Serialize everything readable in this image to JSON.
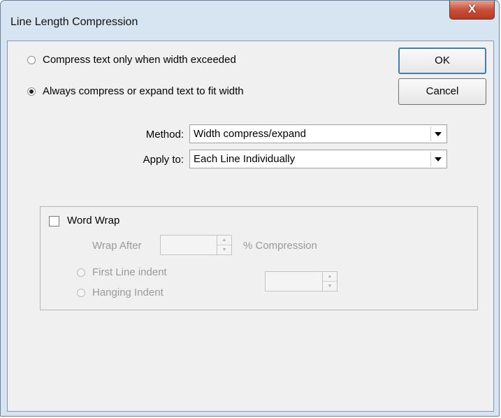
{
  "window": {
    "title": "Line Length Compression",
    "close_label": "X"
  },
  "options": {
    "compress_when_exceeded": "Compress text only when width exceeded",
    "always_compress": "Always compress or expand text to fit width",
    "selected": "always_compress"
  },
  "buttons": {
    "ok": "OK",
    "cancel": "Cancel"
  },
  "method": {
    "label": "Method:",
    "value": "Width compress/expand"
  },
  "apply_to": {
    "label": "Apply to:",
    "value": "Each Line Individually"
  },
  "word_wrap": {
    "label": "Word Wrap",
    "checked": false,
    "wrap_after_label": "Wrap After",
    "wrap_after_value": "",
    "compression_label": "% Compression",
    "first_line_indent": "First Line indent",
    "hanging_indent": "Hanging Indent",
    "indent_value": ""
  },
  "icons": {
    "dropdown": "chevron-down-icon",
    "spin_up": "spin-up-icon",
    "spin_down": "spin-down-icon"
  }
}
